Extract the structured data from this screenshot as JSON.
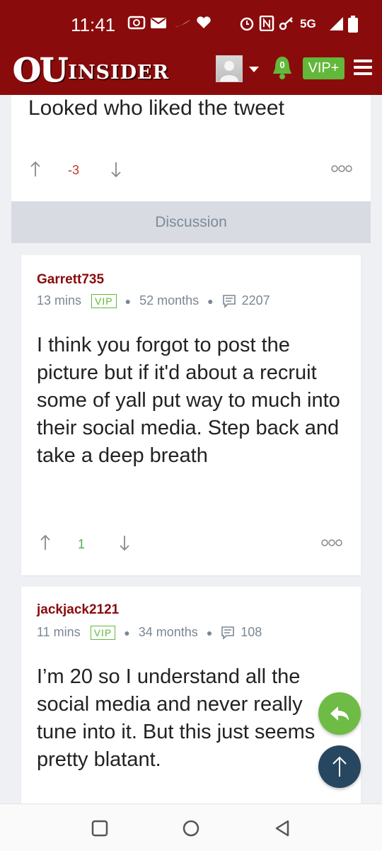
{
  "status_bar": {
    "time": "11:41",
    "network": "5G",
    "icons": [
      "radio-icon",
      "mail-icon",
      "nike-icon",
      "iheart-icon",
      "alarm-icon",
      "nfc-icon",
      "key-icon",
      "signal-icon",
      "battery-icon"
    ]
  },
  "header": {
    "logo_ou": "OU",
    "logo_insider": "INSIDER",
    "notification_count": "0",
    "vip_button": "VIP+"
  },
  "prev_post": {
    "text": "Looked who liked the tweet",
    "score": "-3"
  },
  "discussion_label": "Discussion",
  "posts": [
    {
      "username": "Garrett735",
      "time": "13 mins",
      "badge": "VIP",
      "tenure": "52 months",
      "post_count": "2207",
      "text": "I think you forgot to post the picture but if it'd about a recruit some of yall put way to much into their social media. Step back and take a deep breath",
      "score": "1"
    },
    {
      "username": "jackjack2121",
      "time": "11 mins",
      "badge": "VIP",
      "tenure": "34 months",
      "post_count": "108",
      "text": "I’m 20 so I understand all the social media and never really tune into it. But this just seems pretty blatant."
    }
  ],
  "colors": {
    "brand": "#8a0b0b",
    "vip_green": "#62b83a",
    "negative_score": "#c0392b",
    "positive_score": "#4caf50",
    "scroll_top": "#274761"
  }
}
